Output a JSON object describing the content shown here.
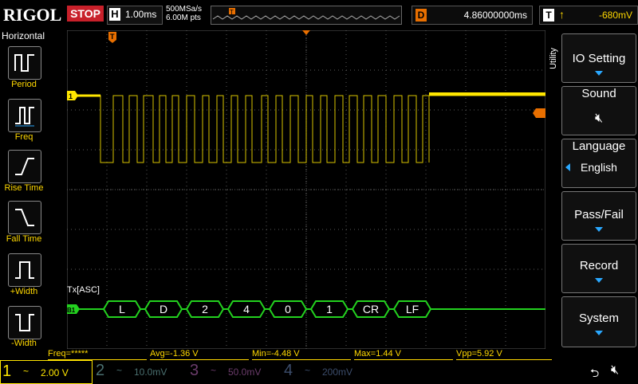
{
  "topbar": {
    "logo": "RIGOL",
    "run_status": "STOP",
    "timebase_label": "H",
    "timebase_value": "1.00ms",
    "sample_rate": "500MSa/s",
    "memory_depth": "6.00M pts",
    "delay_label": "D",
    "delay_value": "4.86000000ms",
    "trigger_label": "T",
    "trigger_level": "-680mV",
    "colors": {
      "stop": "#c8202a",
      "delay": "#e86f00",
      "trigger": "#ffd800"
    }
  },
  "leftpanel": {
    "title": "Horizontal",
    "items": [
      {
        "label": "Period",
        "icon": "period-icon"
      },
      {
        "label": "Freq",
        "icon": "freq-icon"
      },
      {
        "label": "Rise Time",
        "icon": "rise-time-icon"
      },
      {
        "label": "Fall Time",
        "icon": "fall-time-icon"
      },
      {
        "label": "+Width",
        "icon": "pos-width-icon"
      },
      {
        "label": "-Width",
        "icon": "neg-width-icon"
      }
    ]
  },
  "screen": {
    "ch1_marker": "1",
    "bus_marker": "B1",
    "trigger_marker": "T",
    "decode_label": "Tx[ASC]",
    "decode_bytes": [
      "L",
      "D",
      "2",
      "4",
      "0",
      "1",
      "CR",
      "LF"
    ],
    "colors": {
      "ch1": "#ffe600",
      "bus": "#23d11f",
      "grid": "#5a5a5a"
    }
  },
  "rightmenu": {
    "title": "Utility",
    "items": [
      {
        "label": "IO Setting"
      },
      {
        "label": "Sound"
      },
      {
        "label": "Language",
        "value": "English"
      },
      {
        "label": "Pass/Fail"
      },
      {
        "label": "Record"
      },
      {
        "label": "System"
      }
    ]
  },
  "measurements": {
    "freq": "Freq=*****",
    "avg": "Avg=-1.36 V",
    "min": "Min=-4.48 V",
    "max": "Max=1.44 V",
    "vpp": "Vpp=5.92 V"
  },
  "bottombar": {
    "channels": [
      {
        "num": "1",
        "coupling": "~",
        "scale": "2.00 V",
        "color": "#ffe600"
      },
      {
        "num": "2",
        "coupling": "~",
        "scale": "10.0mV",
        "color": "#4a6f6f"
      },
      {
        "num": "3",
        "coupling": "~",
        "scale": "50.0mV",
        "color": "#6b3c6b"
      },
      {
        "num": "4",
        "coupling": "~",
        "scale": "200mV",
        "color": "#3c4d6b"
      }
    ]
  }
}
